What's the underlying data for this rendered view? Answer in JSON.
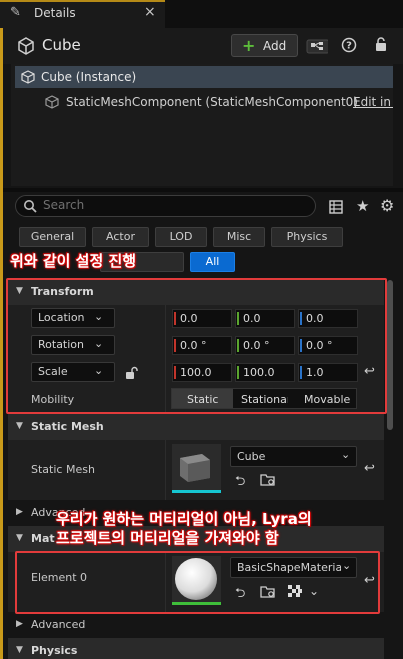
{
  "tab": {
    "title": "Details",
    "close": "×"
  },
  "header": {
    "object_name": "Cube",
    "add_label": "Add"
  },
  "tree": {
    "instance_label": "Cube (Instance)",
    "component_label": "StaticMeshComponent (StaticMeshComponent0)",
    "edit_label": "Edit in C++"
  },
  "search": {
    "placeholder": "Search"
  },
  "filters": [
    "General",
    "Actor",
    "LOD",
    "Misc",
    "Physics"
  ],
  "filter_all": "All",
  "annotation1": "위와 같이 설정 진행",
  "annotation2_line1": "우리가 원하는 머티리얼이 아님, Lyra의",
  "annotation2_line2": "프로젝트의 머티리얼을 가져와야 함",
  "transform": {
    "title": "Transform",
    "location": {
      "label": "Location",
      "x": "0.0",
      "y": "0.0",
      "z": "0.0"
    },
    "rotation": {
      "label": "Rotation",
      "x": "0.0 °",
      "y": "0.0 °",
      "z": "0.0 °"
    },
    "scale": {
      "label": "Scale",
      "x": "100.0",
      "y": "100.0",
      "z": "1.0"
    },
    "mobility": {
      "label": "Mobility",
      "options": [
        "Static",
        "Stationary",
        "Movable"
      ],
      "selected": "Static"
    }
  },
  "static_mesh": {
    "title": "Static Mesh",
    "label": "Static Mesh",
    "value": "Cube",
    "advanced": "Advanced"
  },
  "materials": {
    "title": "Materials",
    "element_label": "Element 0",
    "value": "BasicShapeMaterial",
    "advanced": "Advanced"
  },
  "physics": {
    "title": "Physics"
  },
  "colors": {
    "accent": "#0a6ad1",
    "x_axis": "#c1352b",
    "y_axis": "#5ba52f",
    "z_axis": "#2a73c9",
    "highlight": "#e23b3b"
  }
}
